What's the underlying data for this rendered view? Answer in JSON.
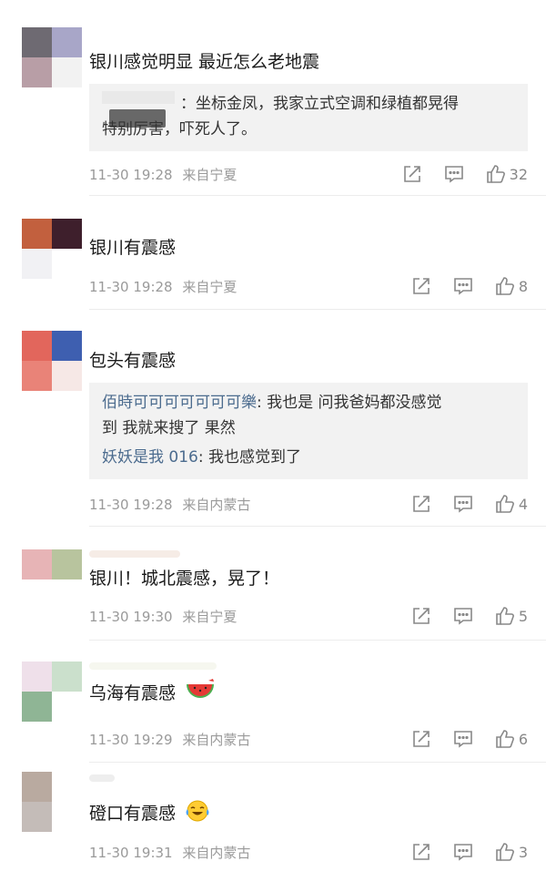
{
  "comments": [
    {
      "text": "银川感觉明显   最近怎么老地震",
      "reply_lines": [
        "：坐标金凤，我家立式空调和绿植都晃得",
        "特别厉害，吓死人了。"
      ],
      "time": "11-30 19:28",
      "source": "来自宁夏",
      "likes": "32"
    },
    {
      "text": "银川有震感",
      "time": "11-30 19:28",
      "source": "来自宁夏",
      "likes": "8"
    },
    {
      "text": "包头有震感",
      "replies": [
        {
          "name": "佰時可可可可可可可樂",
          "line1": ": 我也是 问我爸妈都没感觉",
          "line2": "到 我就来搜了 果然"
        },
        {
          "name": "妖妖是我 016",
          "line1": ": 我也感觉到了"
        }
      ],
      "time": "11-30 19:28",
      "source": "来自内蒙古",
      "likes": "4"
    },
    {
      "text": "银川！城北震感，晃了！",
      "time": "11-30 19:30",
      "source": "来自宁夏",
      "likes": "5"
    },
    {
      "text": "乌海有震感",
      "emoji": "watermelon-emoji",
      "time": "11-30 19:29",
      "source": "来自内蒙古",
      "likes": "6"
    },
    {
      "text": "磴口有震感",
      "emoji": "laughing-crying-emoji",
      "time": "11-30 19:31",
      "source": "来自内蒙古",
      "likes": "3"
    }
  ],
  "icons": {
    "forward": "forward-icon",
    "comment": "comment-icon",
    "like": "like-icon"
  },
  "colors": {
    "reply_name": "#4b6b8e",
    "meta_text": "#9a9a9a",
    "reply_bg": "#f2f2f2"
  }
}
